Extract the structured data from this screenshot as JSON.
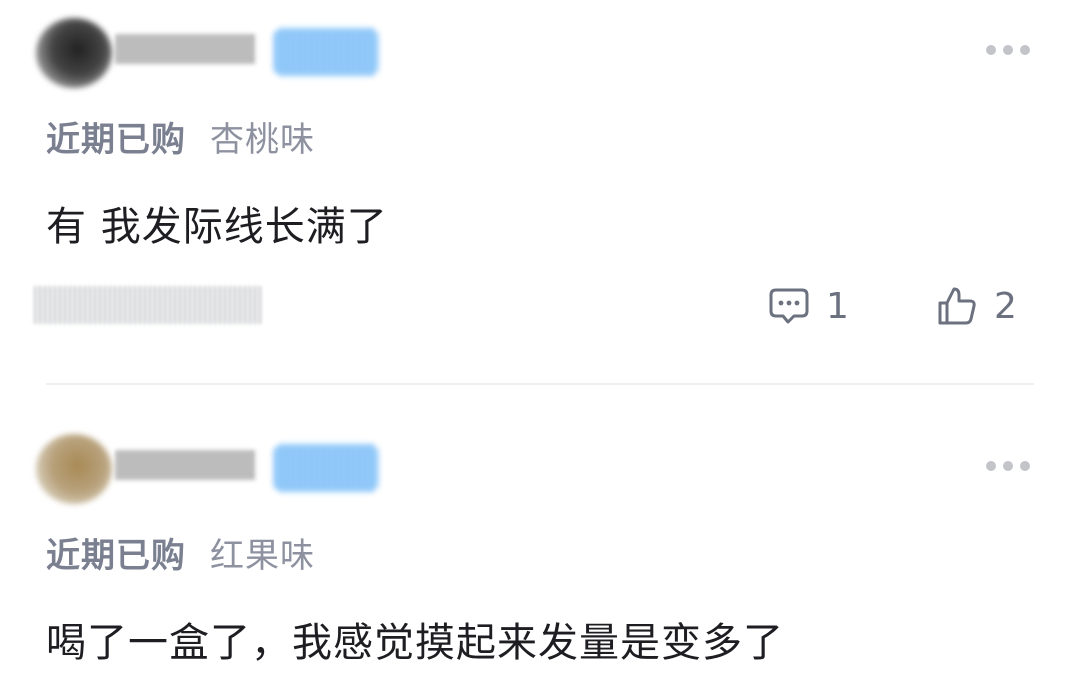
{
  "comments": [
    {
      "purchase_label": "近期已购",
      "flavor": "杏桃味",
      "text": "有 我发际线长满了",
      "reply_count": "1",
      "like_count": "2"
    },
    {
      "purchase_label": "近期已购",
      "flavor": "红果味",
      "text": "喝了一盒了，我感觉摸起来发量是变多了"
    }
  ],
  "icons": {
    "more": "more-dots-icon",
    "reply": "comment-bubble-icon",
    "like": "thumbs-up-icon"
  },
  "colors": {
    "meta_text": "#7b8091",
    "icon_gray": "#6c7180",
    "body_text": "#1d1d22",
    "divider": "#efeff2"
  }
}
